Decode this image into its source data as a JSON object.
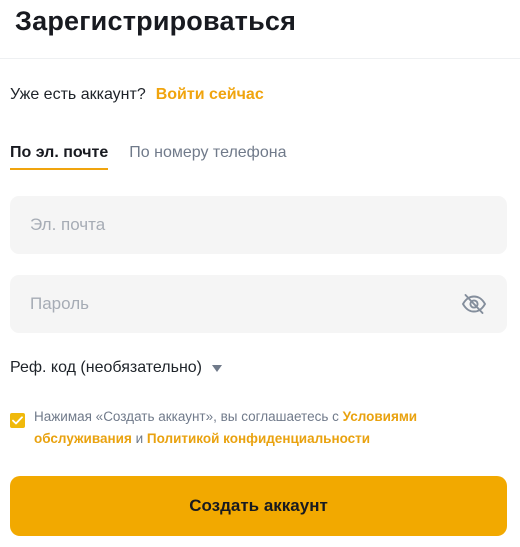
{
  "header": {
    "title": "Зарегистрироваться"
  },
  "login_prompt": {
    "question": "Уже есть аккаунт?",
    "link_label": "Войти сейчас"
  },
  "tabs": [
    {
      "label": "По эл. почте",
      "active": true
    },
    {
      "label": "По номеру телефона",
      "active": false
    }
  ],
  "email_field": {
    "value": "",
    "placeholder": "Эл. почта"
  },
  "password_field": {
    "value": "",
    "placeholder": "Пароль",
    "toggle_icon": "eye-off-icon"
  },
  "referral": {
    "label": "Реф. код (необязательно)",
    "icon": "caret-down-icon"
  },
  "agreement": {
    "checked": true,
    "text_before": "Нажимая «Создать аккаунт», вы соглашаетесь с ",
    "terms_link": "Условиями обслуживания",
    "text_and": " и ",
    "privacy_link": "Политикой конфиденциальности"
  },
  "submit": {
    "label": "Создать аккаунт"
  },
  "colors": {
    "accent": "#f0a40e",
    "button": "#f2a900",
    "input_bg": "#f5f5f5",
    "muted_text": "#707a8a",
    "text": "#1e2329"
  }
}
